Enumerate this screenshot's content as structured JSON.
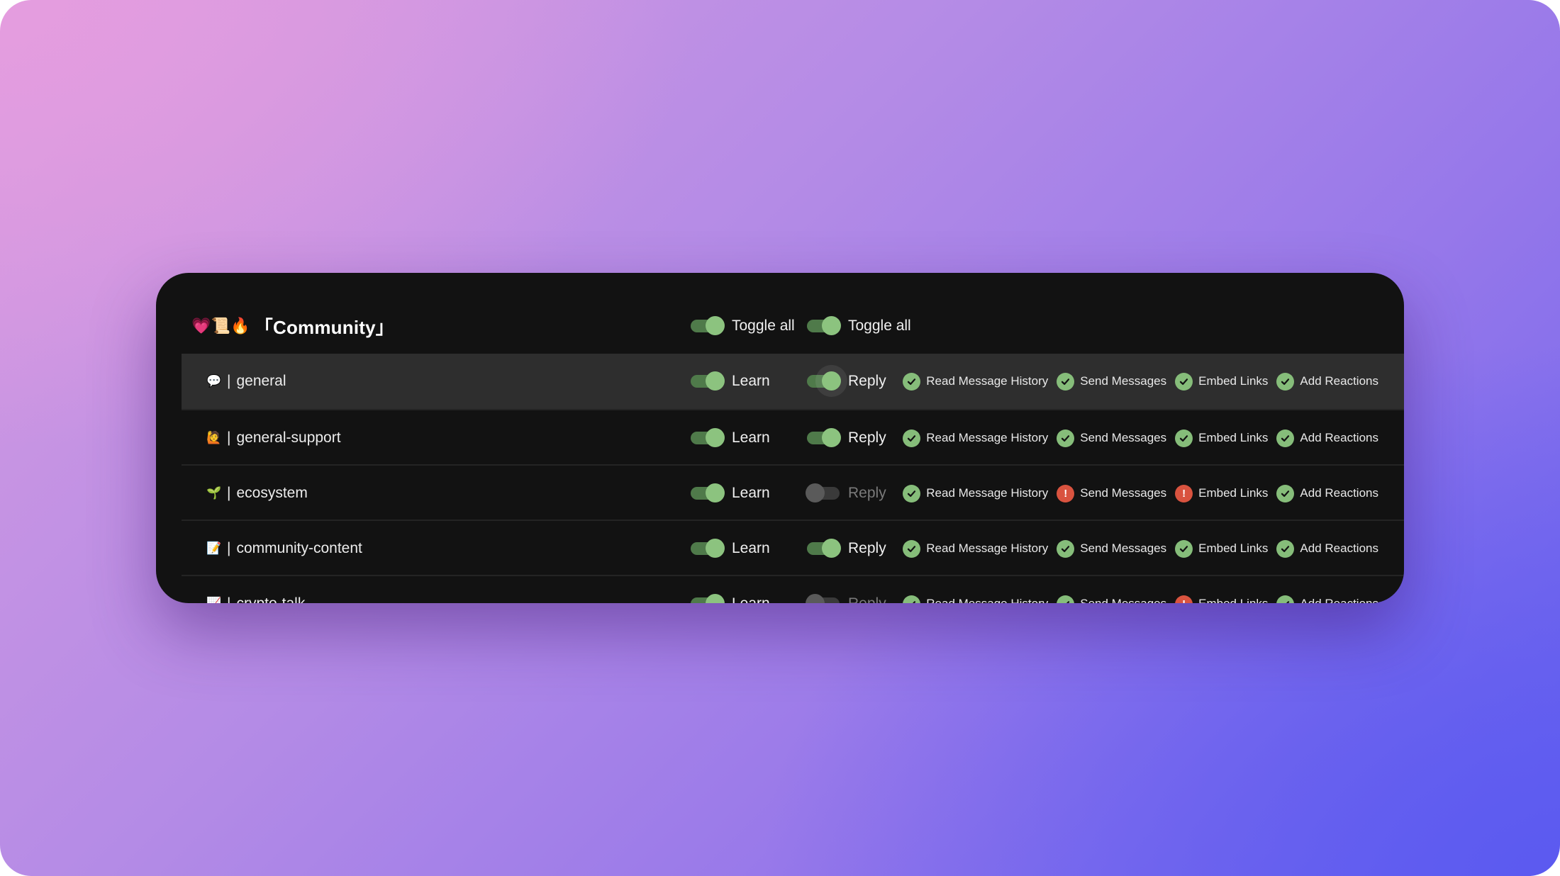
{
  "category": {
    "emoji": "💗📜🔥",
    "title": "「Community」",
    "toggle_all_learn": "Toggle all",
    "toggle_all_reply": "Toggle all"
  },
  "labels": {
    "learn": "Learn",
    "reply": "Reply"
  },
  "colors": {
    "toggle_on_track": "#4f7a4a",
    "toggle_on_knob": "#8cc37f",
    "ok": "#86bd7a",
    "warn": "#d9533f"
  },
  "channels": [
    {
      "emoji": "💬",
      "separator": "|",
      "name": "general",
      "learn_on": true,
      "reply_on": true,
      "permissions": [
        {
          "label": "Read Message History",
          "status": "ok"
        },
        {
          "label": "Send Messages",
          "status": "ok"
        },
        {
          "label": "Embed Links",
          "status": "ok"
        },
        {
          "label": "Add Reactions",
          "status": "ok"
        }
      ]
    },
    {
      "emoji": "🙋",
      "separator": "|",
      "name": "general-support",
      "learn_on": true,
      "reply_on": true,
      "permissions": [
        {
          "label": "Read Message History",
          "status": "ok"
        },
        {
          "label": "Send Messages",
          "status": "ok"
        },
        {
          "label": "Embed Links",
          "status": "ok"
        },
        {
          "label": "Add Reactions",
          "status": "ok"
        }
      ]
    },
    {
      "emoji": "🌱",
      "separator": "|",
      "name": "ecosystem",
      "learn_on": true,
      "reply_on": false,
      "permissions": [
        {
          "label": "Read Message History",
          "status": "ok"
        },
        {
          "label": "Send Messages",
          "status": "warning"
        },
        {
          "label": "Embed Links",
          "status": "warning"
        },
        {
          "label": "Add Reactions",
          "status": "ok"
        }
      ]
    },
    {
      "emoji": "📝",
      "separator": "|",
      "name": "community-content",
      "learn_on": true,
      "reply_on": true,
      "permissions": [
        {
          "label": "Read Message History",
          "status": "ok"
        },
        {
          "label": "Send Messages",
          "status": "ok"
        },
        {
          "label": "Embed Links",
          "status": "ok"
        },
        {
          "label": "Add Reactions",
          "status": "ok"
        }
      ]
    },
    {
      "emoji": "📈",
      "separator": "|",
      "name": "crypto-talk",
      "learn_on": true,
      "reply_on": false,
      "permissions": [
        {
          "label": "Read Message History",
          "status": "ok"
        },
        {
          "label": "Send Messages",
          "status": "ok"
        },
        {
          "label": "Embed Links",
          "status": "warning"
        },
        {
          "label": "Add Reactions",
          "status": "ok"
        }
      ]
    }
  ]
}
